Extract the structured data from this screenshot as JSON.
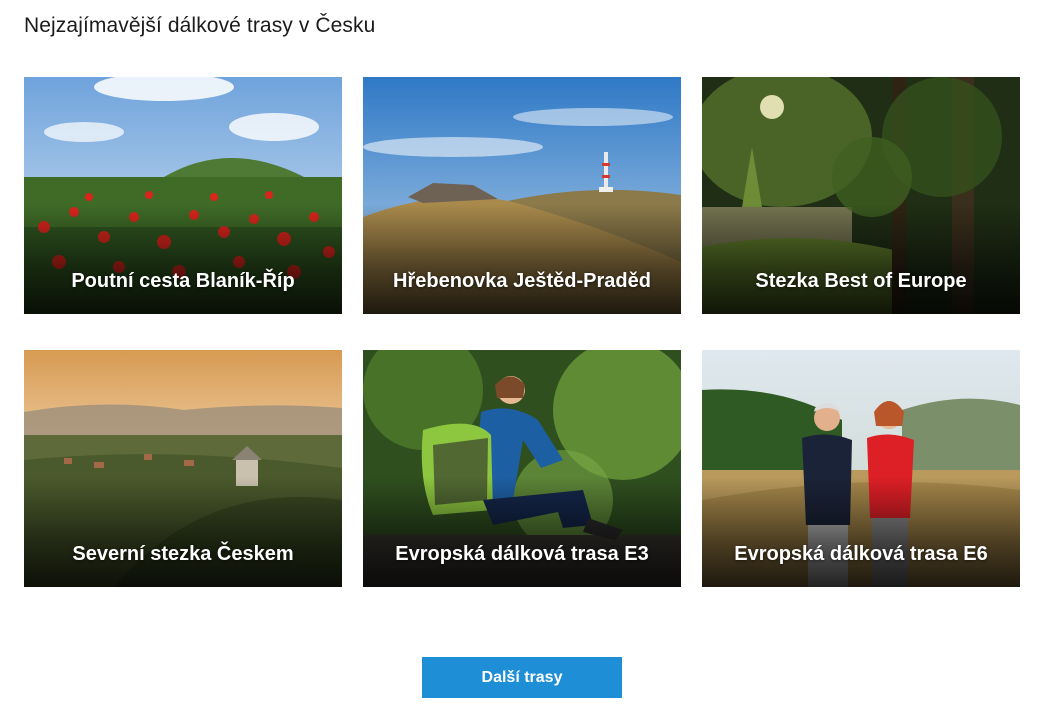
{
  "section": {
    "title": "Nejzajímavější dálkové trasy v Česku"
  },
  "trails": [
    {
      "name": "Poutní cesta Blaník-Říp"
    },
    {
      "name": "Hřebenovka Ještěd-Praděd"
    },
    {
      "name": "Stezka Best of Europe"
    },
    {
      "name": "Severní stezka Českem"
    },
    {
      "name": "Evropská dálková trasa E3"
    },
    {
      "name": "Evropská dálková trasa E6"
    }
  ],
  "more_button": {
    "label": "Další trasy"
  },
  "colors": {
    "accent": "#1e8fd6",
    "heading_text": "#1b1b1b",
    "card_label": "#ffffff"
  }
}
